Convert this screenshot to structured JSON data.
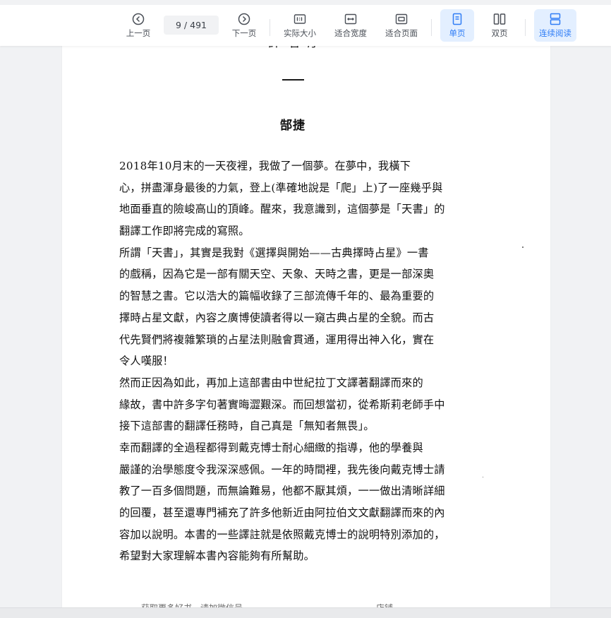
{
  "toolbar": {
    "prev_label": "上一页",
    "current_page": "9",
    "page_separator": " / ",
    "total_pages": "491",
    "next_label": "下一页",
    "actual_size_label": "实际大小",
    "fit_width_label": "适合宽度",
    "fit_page_label": "适合页面",
    "single_page_label": "单页",
    "double_page_label": "双页",
    "continuous_label": "连续阅读",
    "active_color": "#2f7df6"
  },
  "document": {
    "cut_heading": "譯 者 序",
    "section_number_dash": "—",
    "author": "郜捷",
    "lines": [
      "    2018年10月末的一天夜裡，我做了一個夢。在夢中，我橫下",
      "心，拼盡渾身最後的力氣，登上(準確地說是「爬」上)了一座幾乎與",
      "地面垂直的險峻高山的頂峰。醒來，我意識到，這個夢是「天書」的",
      "翻譯工作即將完成的寫照。",
      "    所謂「天書」，其實是我對《選擇與開始——古典擇時占星》一書",
      "的戲稱，因為它是一部有關天空、天象、天時之書，更是一部深奧",
      "的智慧之書。它以浩大的篇幅收錄了三部流傳千年的、最為重要的",
      "擇時占星文獻，內容之廣博使讀者得以一窺古典占星的全貌。而古",
      "代先賢們將複雜繁瑣的占星法則融會貫通，運用得出神入化，實在",
      "令人嘆服！",
      "    然而正因為如此，再加上這部書由中世紀拉丁文譯著翻譯而來的",
      "緣故，書中許多字句著實晦澀艱深。而回想當初，從希斯莉老師手中",
      "接下這部書的翻譯任務時，自己真是「無知者無畏」。",
      "    幸而翻譯的全過程都得到戴克博士耐心細緻的指導，他的學養與",
      "嚴謹的治學態度令我深深感佩。一年的時間裡，我先後向戴克博士請",
      "教了一百多個問題，而無論難易，他都不厭其煩，一一做出清晰詳細",
      "的回覆，甚至還專門補充了許多他新近由阿拉伯文文獻翻譯而來的內",
      "容加以說明。本書的一些譯註就是依照戴克博士的說明特別添加的，",
      "希望對大家理解本書內容能夠有所幫助。"
    ],
    "footer_left": "获取更多好书，请加微信号",
    "footer_right": "店铺"
  }
}
